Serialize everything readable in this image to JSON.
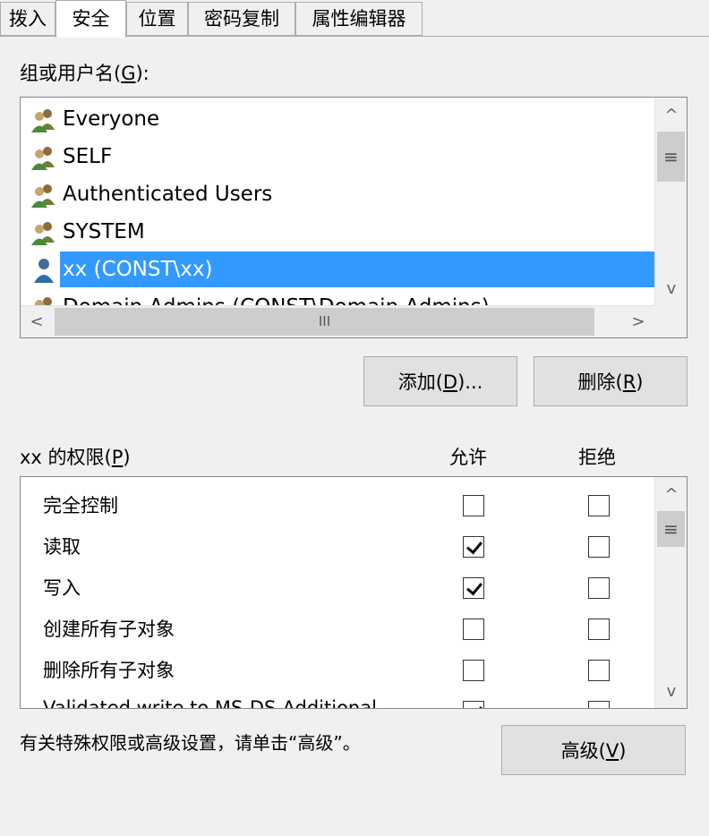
{
  "tabs": [
    {
      "label": "拨入",
      "active": false
    },
    {
      "label": "安全",
      "active": true
    },
    {
      "label": "位置",
      "active": false
    },
    {
      "label": "密码复制",
      "active": false
    },
    {
      "label": "属性编辑器",
      "active": false
    }
  ],
  "groups_label": {
    "text": "组或用户名(",
    "key": "G",
    "suffix": "):"
  },
  "groups": [
    {
      "name": "Everyone",
      "icon": "user-group-icon",
      "selected": false
    },
    {
      "name": "SELF",
      "icon": "user-group-icon",
      "selected": false
    },
    {
      "name": "Authenticated Users",
      "icon": "user-group-icon",
      "selected": false
    },
    {
      "name": "SYSTEM",
      "icon": "user-group-icon",
      "selected": false
    },
    {
      "name": "xx (CONST\\xx)",
      "icon": "user-icon",
      "selected": true
    },
    {
      "name": "Domain Admins (CONST\\Domain Admins)",
      "icon": "user-group-icon",
      "selected": false
    }
  ],
  "buttons": {
    "add": {
      "text": "添加(",
      "key": "D",
      "suffix": ")..."
    },
    "remove": {
      "text": "删除(",
      "key": "R",
      "suffix": ")"
    },
    "advanced": {
      "text": "高级(",
      "key": "V",
      "suffix": ")"
    }
  },
  "permissions_label": {
    "text": "xx 的权限(",
    "key": "P",
    "suffix": ")"
  },
  "columns": {
    "allow": "允许",
    "deny": "拒绝"
  },
  "permissions": [
    {
      "name": "完全控制",
      "allow": false,
      "deny": false
    },
    {
      "name": "读取",
      "allow": true,
      "deny": false
    },
    {
      "name": "写入",
      "allow": true,
      "deny": false
    },
    {
      "name": "创建所有子对象",
      "allow": false,
      "deny": false
    },
    {
      "name": "删除所有子对象",
      "allow": false,
      "deny": false
    },
    {
      "name": "Validated write to MS-DS-Additional",
      "allow": true,
      "deny": false
    }
  ],
  "footer_text": "有关特殊权限或高级设置，请单击“高级”。",
  "scroll_glyphs": {
    "up": "^",
    "down": "v",
    "left": "<",
    "right": ">",
    "grip_v": "≡",
    "grip_h": "III"
  }
}
